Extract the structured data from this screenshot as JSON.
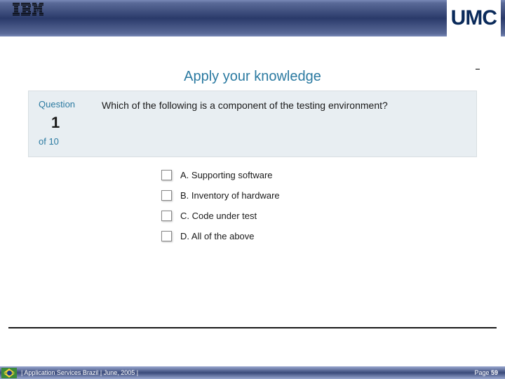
{
  "header": {
    "left_logo": "IBM",
    "right_logo": "UMC"
  },
  "title": "Apply your knowledge",
  "question": {
    "label": "Question",
    "number": "1",
    "of": "of 10",
    "text": "Which of the following is a component of the testing environment?"
  },
  "answers": [
    {
      "label": "A. Supporting software"
    },
    {
      "label": "B. Inventory of hardware"
    },
    {
      "label": "C. Code under test"
    },
    {
      "label": "D. All of the above"
    }
  ],
  "footer": {
    "text": "|  Application Services Brazil  |  June, 2005  |",
    "page_label": "Page ",
    "page_number": "59"
  }
}
